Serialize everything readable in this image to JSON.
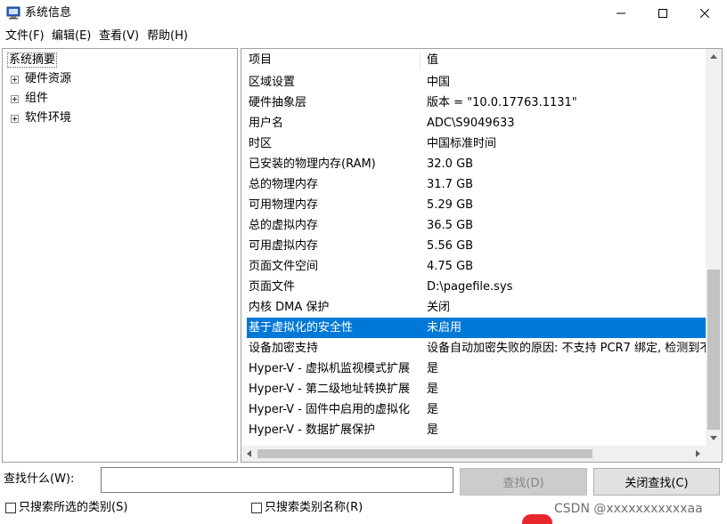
{
  "window": {
    "title": "系统信息"
  },
  "menu": [
    "文件(F)",
    "编辑(E)",
    "查看(V)",
    "帮助(H)"
  ],
  "tree": {
    "root": "系统摘要",
    "children": [
      "硬件资源",
      "组件",
      "软件环境"
    ]
  },
  "list": {
    "columns": [
      "项目",
      "值"
    ],
    "rows": [
      {
        "item": "区域设置",
        "value": "中国"
      },
      {
        "item": "硬件抽象层",
        "value": "版本 = \"10.0.17763.1131\""
      },
      {
        "item": "用户名",
        "value": "ADC\\S9049633"
      },
      {
        "item": "时区",
        "value": "中国标准时间"
      },
      {
        "item": "已安装的物理内存(RAM)",
        "value": "32.0 GB"
      },
      {
        "item": "总的物理内存",
        "value": "31.7 GB"
      },
      {
        "item": "可用物理内存",
        "value": "5.29 GB"
      },
      {
        "item": "总的虚拟内存",
        "value": "36.5 GB"
      },
      {
        "item": "可用虚拟内存",
        "value": "5.56 GB"
      },
      {
        "item": "页面文件空间",
        "value": "4.75 GB"
      },
      {
        "item": "页面文件",
        "value": "D:\\pagefile.sys"
      },
      {
        "item": "内核 DMA 保护",
        "value": "关闭"
      },
      {
        "item": "基于虚拟化的安全性",
        "value": "未启用",
        "selected": true
      },
      {
        "item": "设备加密支持",
        "value": "设备自动加密失败的原因: 不支持 PCR7 绑定, 检测到不"
      },
      {
        "item": "Hyper-V - 虚拟机监视模式扩展",
        "value": "是"
      },
      {
        "item": "Hyper-V - 第二级地址转换扩展",
        "value": "是"
      },
      {
        "item": "Hyper-V - 固件中启用的虚拟化",
        "value": "是"
      },
      {
        "item": "Hyper-V - 数据扩展保护",
        "value": "是"
      }
    ]
  },
  "search": {
    "label": "查找什么(W):",
    "input_value": "",
    "find_button": "查找(D)",
    "close_button": "关闭查找(C)",
    "checkbox_selected_category": "只搜索所选的类别(S)",
    "checkbox_category_names": "只搜索类别名称(R)",
    "checkbox_selected_category_checked": false,
    "checkbox_category_names_checked": false
  },
  "background": {
    "watermark": "CSDN @xxxxxxxxxxxaa"
  },
  "colors": {
    "selection": "#0078d7",
    "border": "#a0a0a0"
  }
}
